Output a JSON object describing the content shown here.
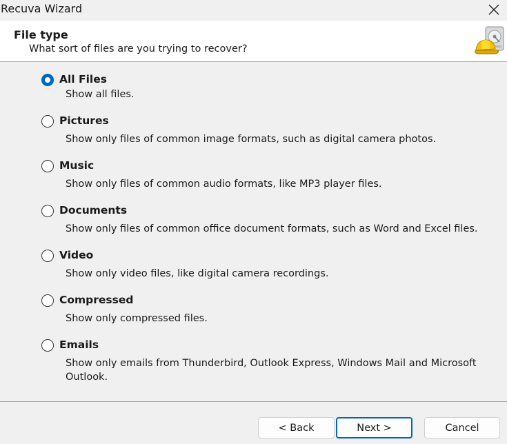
{
  "window": {
    "title": "Recuva Wizard"
  },
  "header": {
    "title": "File type",
    "subtitle": "What sort of files are you trying to recover?"
  },
  "options": [
    {
      "label": "All Files",
      "description": "Show all files.",
      "checked": true
    },
    {
      "label": "Pictures",
      "description": "Show only files of common image formats, such as digital camera photos.",
      "checked": false
    },
    {
      "label": "Music",
      "description": "Show only files of common audio formats, like MP3 player files.",
      "checked": false
    },
    {
      "label": "Documents",
      "description": "Show only files of common office document formats, such as Word and Excel files.",
      "checked": false
    },
    {
      "label": "Video",
      "description": "Show only video files, like digital camera recordings.",
      "checked": false
    },
    {
      "label": "Compressed",
      "description": "Show only compressed files.",
      "checked": false
    },
    {
      "label": "Emails",
      "description": "Show only emails from Thunderbird, Outlook Express, Windows Mail and Microsoft Outlook.",
      "checked": false
    }
  ],
  "buttons": {
    "back": "< Back",
    "next": "Next >",
    "cancel": "Cancel"
  },
  "colors": {
    "accent": "#0067c0",
    "header_bg": "#ffffff",
    "window_bg": "#f0f0f0"
  },
  "icons": {
    "close": "close-icon",
    "logo": "recuva-hardhat-drive-icon"
  }
}
